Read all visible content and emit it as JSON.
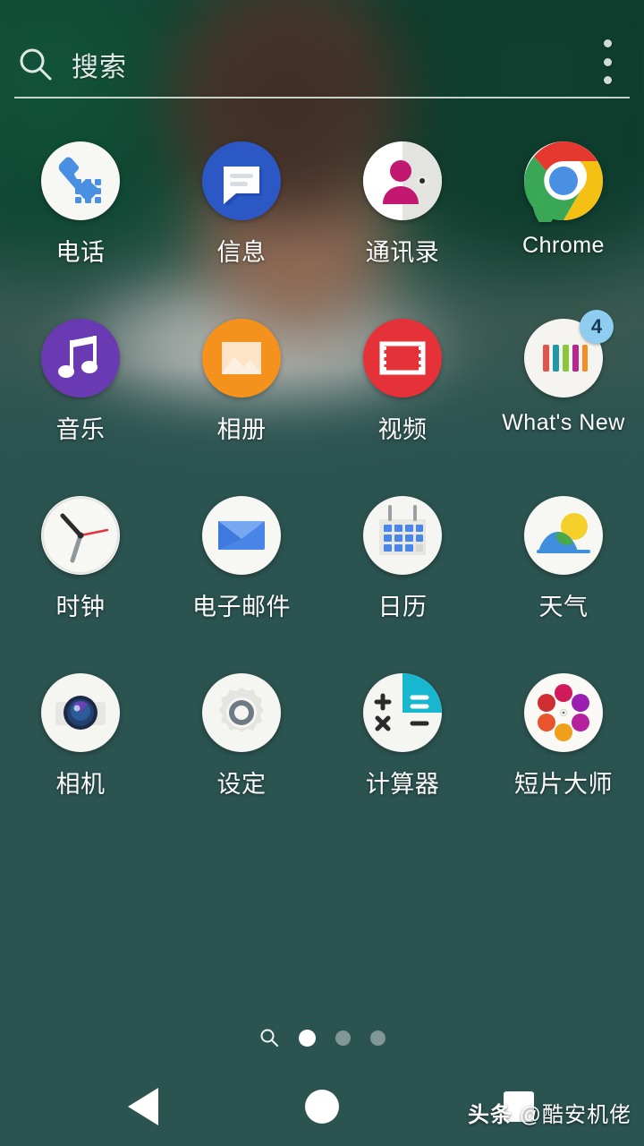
{
  "screen": {
    "background_color": "#2b5350",
    "type": "android-app-drawer"
  },
  "search": {
    "placeholder": "搜索",
    "icon": "search-icon",
    "overflow_icon": "overflow-menu-icon"
  },
  "apps": [
    {
      "label": "电话",
      "icon": "phone-dialer-icon",
      "badge": null
    },
    {
      "label": "信息",
      "icon": "messages-icon",
      "badge": null
    },
    {
      "label": "通讯录",
      "icon": "contacts-icon",
      "badge": null
    },
    {
      "label": "Chrome",
      "icon": "chrome-icon",
      "badge": null
    },
    {
      "label": "音乐",
      "icon": "music-note-icon",
      "badge": null
    },
    {
      "label": "相册",
      "icon": "album-gallery-icon",
      "badge": null
    },
    {
      "label": "视频",
      "icon": "video-film-icon",
      "badge": null
    },
    {
      "label": "What's New",
      "icon": "whats-new-icon",
      "badge": "4"
    },
    {
      "label": "时钟",
      "icon": "clock-icon",
      "badge": null
    },
    {
      "label": "电子邮件",
      "icon": "email-envelope-icon",
      "badge": null
    },
    {
      "label": "日历",
      "icon": "calendar-icon",
      "badge": null
    },
    {
      "label": "天气",
      "icon": "weather-sun-icon",
      "badge": null
    },
    {
      "label": "相机",
      "icon": "camera-icon",
      "badge": null
    },
    {
      "label": "设定",
      "icon": "settings-gear-icon",
      "badge": null
    },
    {
      "label": "计算器",
      "icon": "calculator-icon",
      "badge": null
    },
    {
      "label": "短片大师",
      "icon": "movie-creator-icon",
      "badge": null
    }
  ],
  "pager": {
    "search_icon": "search-icon",
    "page_count": 3,
    "active_page": 1
  },
  "navbar": {
    "back": "back-button",
    "home": "home-button",
    "recents": "recents-button"
  },
  "watermark": {
    "prefix": "头条",
    "handle": "@酷安机佬"
  },
  "colors": {
    "background": "#2b5350",
    "badge": "#8ecdf0",
    "badge_text": "#173a52",
    "label_text": "#ffffff",
    "phone_blue": "#4a90e2",
    "messages_blue": "#2b58c4",
    "contacts_pink": "#c2186f",
    "music_purple": "#6a3ab2",
    "album_orange": "#f5921e",
    "video_red": "#e53238",
    "calc_cyan": "#17b8cf"
  }
}
